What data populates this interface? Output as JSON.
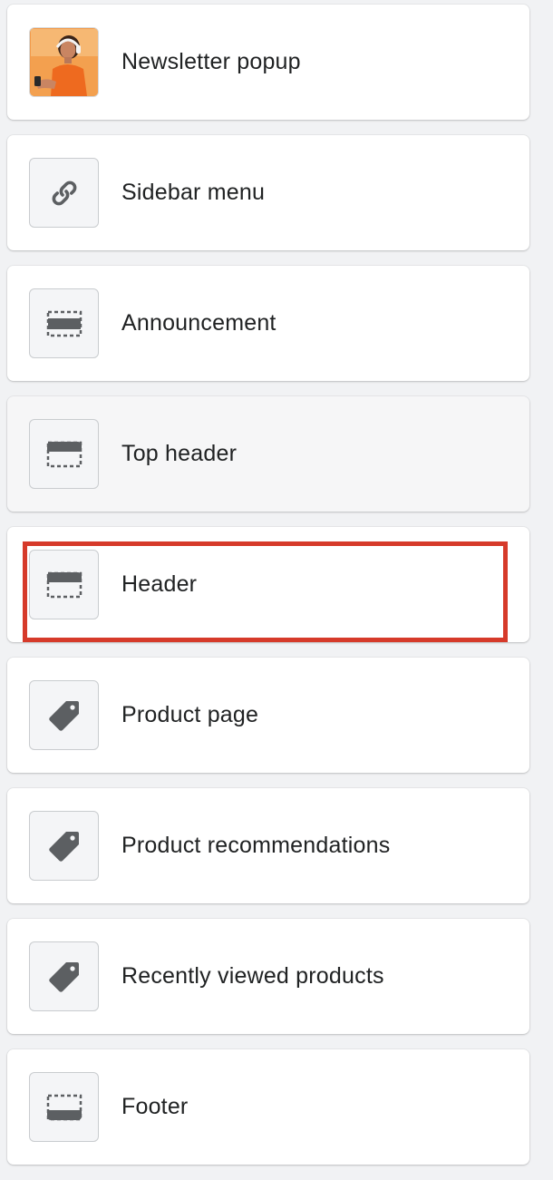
{
  "sections": [
    {
      "label": "Newsletter popup",
      "icon": "newsletter-photo-icon"
    },
    {
      "label": "Sidebar menu",
      "icon": "link-icon"
    },
    {
      "label": "Announcement",
      "icon": "section-announcement-icon"
    },
    {
      "label": "Top header",
      "icon": "section-header-icon"
    },
    {
      "label": "Header",
      "icon": "section-header-icon"
    },
    {
      "label": "Product page",
      "icon": "tag-icon"
    },
    {
      "label": "Product recommendations",
      "icon": "tag-icon"
    },
    {
      "label": "Recently viewed products",
      "icon": "tag-icon"
    },
    {
      "label": "Footer",
      "icon": "section-footer-icon"
    }
  ],
  "highlight_color": "#d63a2a",
  "icon_color": "#5c5f62"
}
